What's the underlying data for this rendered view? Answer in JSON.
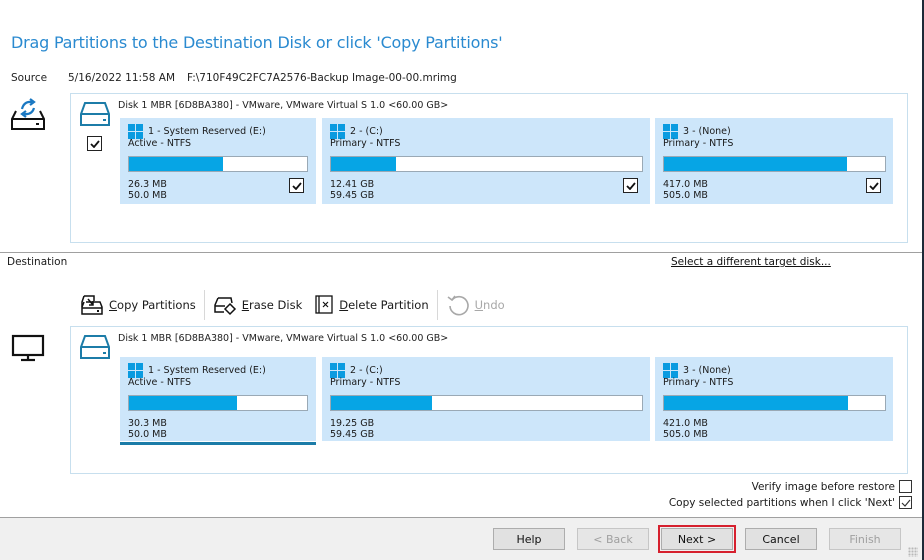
{
  "header": {
    "title": "Drag Partitions to the Destination Disk or click 'Copy Partitions'"
  },
  "source": {
    "label": "Source",
    "datetime": "5/16/2022 11:58 AM",
    "path": "F:\\710F49C2FC7A2576-Backup Image-00-00.mrimg",
    "disk": {
      "header": "Disk 1 MBR [6D8BA380] - VMware,  VMware Virtual S 1.0  <60.00 GB>",
      "checked": true,
      "partitions": [
        {
          "name": "1 - System Reserved (E:)",
          "type": "Active - NTFS",
          "used": "26.3 MB",
          "total": "50.0 MB",
          "used_percent": 52.6,
          "checked": true
        },
        {
          "name": "2 -  (C:)",
          "type": "Primary - NTFS",
          "used": "12.41 GB",
          "total": "59.45 GB",
          "used_percent": 20.9,
          "checked": true
        },
        {
          "name": "3 -  (None)",
          "type": "Primary - NTFS",
          "used": "417.0 MB",
          "total": "505.0 MB",
          "used_percent": 82.6,
          "checked": true
        }
      ]
    }
  },
  "destination": {
    "label": "Destination",
    "select_target_link": "Select a different target disk...",
    "toolbar": {
      "copy_partitions": "Copy Partitions",
      "erase_disk": "Erase Disk",
      "delete_partition": "Delete Partition",
      "undo": "Undo"
    },
    "disk": {
      "header": "Disk 1 MBR [6D8BA380] - VMware,  VMware Virtual S 1.0  <60.00 GB>",
      "partitions": [
        {
          "name": "1 - System Reserved (E:)",
          "type": "Active - NTFS",
          "used": "30.3 MB",
          "total": "50.0 MB",
          "used_percent": 60.6,
          "selected": true
        },
        {
          "name": "2 -  (C:)",
          "type": "Primary - NTFS",
          "used": "19.25 GB",
          "total": "59.45 GB",
          "used_percent": 32.4
        },
        {
          "name": "3 -  (None)",
          "type": "Primary - NTFS",
          "used": "421.0 MB",
          "total": "505.0 MB",
          "used_percent": 83.4
        }
      ]
    }
  },
  "options": {
    "verify_label": "Verify image before restore",
    "verify_checked": false,
    "copy_selected_label": "Copy selected partitions when I click 'Next'",
    "copy_selected_checked": true
  },
  "footer": {
    "help": "Help",
    "back": "< Back",
    "next": "Next >",
    "cancel": "Cancel",
    "finish": "Finish"
  }
}
